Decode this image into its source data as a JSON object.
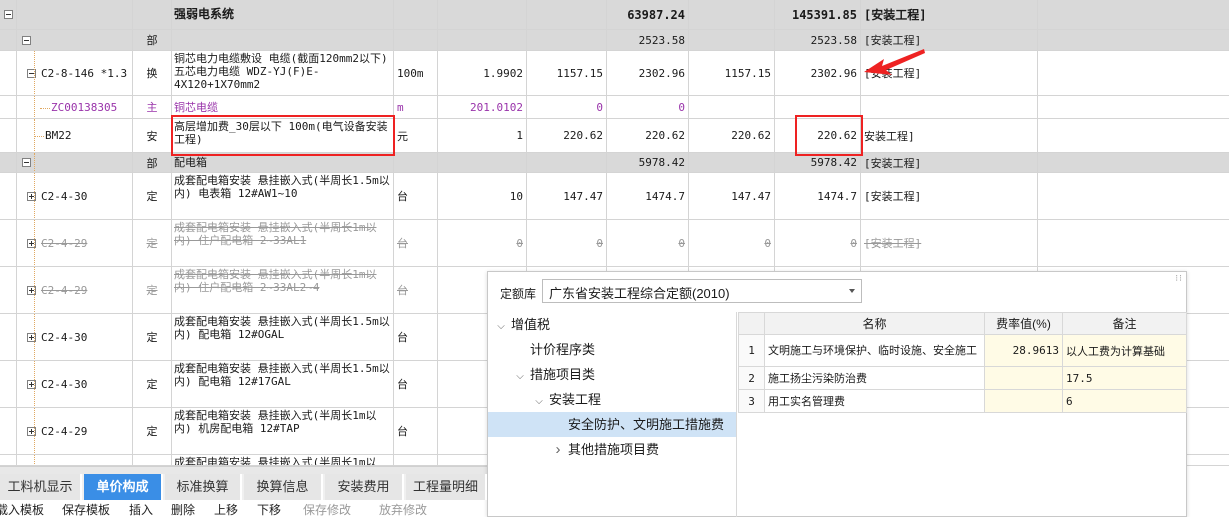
{
  "grid": {
    "rows": [
      {
        "type": "section",
        "toggle": "minus",
        "code": "",
        "category": "",
        "name": "强弱电系统",
        "unit": "",
        "qty": "",
        "unit_price": "",
        "total": "63987.24",
        "unit_price2": "",
        "total2": "145391.85",
        "fee_type": "[安装工程]"
      },
      {
        "type": "section",
        "toggle": "minus",
        "code": "",
        "category": "部",
        "name": "",
        "unit": "",
        "qty": "",
        "unit_price": "",
        "total": "2523.58",
        "unit_price2": "",
        "total2": "2523.58",
        "fee_type": "[安装工程]"
      },
      {
        "type": "normal",
        "toggle": "minus",
        "code": "C2-8-146 *1.3",
        "category": "换",
        "name": "铜芯电力电缆敷设 电缆(截面120mm2以下) 五芯电力电缆 WDZ-YJ(F)E-4X120+1X70mm2",
        "unit": "100m",
        "qty": "1.9902",
        "unit_price": "1157.15",
        "total": "2302.96",
        "unit_price2": "1157.15",
        "total2": "2302.96",
        "fee_type": "[安装工程]"
      },
      {
        "type": "normal",
        "toggle": "",
        "code": "ZC00138305",
        "category": "主",
        "name": "铜芯电缆",
        "unit": "m",
        "qty": "201.0102",
        "unit_price": "0",
        "total": "0",
        "unit_price2": "",
        "total2": "",
        "fee_type": ""
      },
      {
        "type": "normal",
        "toggle": "",
        "code": "BM22",
        "category": "安",
        "name": "高层增加费_30层以下 100m(电气设备安装工程)",
        "unit": "元",
        "qty": "1",
        "unit_price": "220.62",
        "total": "220.62",
        "unit_price2": "220.62",
        "total2": "220.62",
        "fee_type": "安装工程]"
      },
      {
        "type": "section",
        "toggle": "minus",
        "code": "",
        "category": "部",
        "name": "配电箱",
        "unit": "",
        "qty": "",
        "unit_price": "",
        "total": "5978.42",
        "unit_price2": "",
        "total2": "5978.42",
        "fee_type": "[安装工程]"
      },
      {
        "type": "normal",
        "toggle": "plus",
        "code": "C2-4-30",
        "category": "定",
        "name": "成套配电箱安装 悬挂嵌入式(半周长1.5m以内) 电表箱 12#AW1~10",
        "unit": "台",
        "qty": "10",
        "unit_price": "147.47",
        "total": "1474.7",
        "unit_price2": "147.47",
        "total2": "1474.7",
        "fee_type": "[安装工程]"
      },
      {
        "type": "struck",
        "toggle": "plus",
        "code": "C2-4-29",
        "category": "定",
        "name": "成套配电箱安装 悬挂嵌入式(半周长1m以内) 住户配电箱 2~33AL1",
        "unit": "台",
        "qty": "0",
        "unit_price": "0",
        "total": "0",
        "unit_price2": "0",
        "total2": "0",
        "fee_type": "[安装工程]"
      },
      {
        "type": "struck",
        "toggle": "plus",
        "code": "C2-4-29",
        "category": "定",
        "name": "成套配电箱安装 悬挂嵌入式(半周长1m以内) 住户配电箱 2~33AL2~4",
        "unit": "台",
        "qty": "",
        "unit_price": "",
        "total": "",
        "unit_price2": "",
        "total2": "",
        "fee_type": ""
      },
      {
        "type": "normal",
        "toggle": "plus",
        "code": "C2-4-30",
        "category": "定",
        "name": "成套配电箱安装 悬挂嵌入式(半周长1.5m以内) 配电箱 12#OGAL",
        "unit": "台",
        "qty": "",
        "unit_price": "",
        "total": "",
        "unit_price2": "",
        "total2": "",
        "fee_type": ""
      },
      {
        "type": "normal",
        "toggle": "plus",
        "code": "C2-4-30",
        "category": "定",
        "name": "成套配电箱安装 悬挂嵌入式(半周长1.5m以内) 配电箱 12#17GAL",
        "unit": "台",
        "qty": "",
        "unit_price": "",
        "total": "",
        "unit_price2": "",
        "total2": "",
        "fee_type": ""
      },
      {
        "type": "normal",
        "toggle": "plus",
        "code": "C2-4-29",
        "category": "定",
        "name": "成套配电箱安装 悬挂嵌入式(半周长1m以内) 机房配电箱 12#TAP",
        "unit": "台",
        "qty": "",
        "unit_price": "",
        "total": "",
        "unit_price2": "",
        "total2": "",
        "fee_type": ""
      },
      {
        "type": "normal",
        "toggle": "",
        "code": "",
        "category": "",
        "name": "成套配电箱安装 悬挂嵌入式(半周长1m以",
        "unit": "",
        "qty": "",
        "unit_price": "",
        "total": "",
        "unit_price2": "",
        "total2": "",
        "fee_type": ""
      }
    ]
  },
  "panel": {
    "quota_label": "定额库",
    "quota_value": "广东省安装工程综合定额(2010)",
    "tree": [
      {
        "label": "增值税",
        "level": 0,
        "chevron": "down",
        "selected": false
      },
      {
        "label": "计价程序类",
        "level": 1,
        "chevron": "",
        "selected": false
      },
      {
        "label": "措施项目类",
        "level": 1,
        "chevron": "down",
        "selected": false
      },
      {
        "label": "安装工程",
        "level": 2,
        "chevron": "down",
        "selected": false
      },
      {
        "label": "安全防护、文明施工措施费",
        "level": 3,
        "chevron": "",
        "selected": true
      },
      {
        "label": "其他措施项目费",
        "level": 3,
        "chevron": "right",
        "selected": false
      }
    ],
    "table": {
      "headers": [
        "",
        "名称",
        "费率值(%)",
        "备注"
      ],
      "rows": [
        {
          "index": "1",
          "name": "文明施工与环境保护、临时设施、安全施工",
          "rate": "28.9613",
          "note": "以人工费为计算基础"
        },
        {
          "index": "2",
          "name": "施工扬尘污染防治费",
          "rate": "",
          "note": "17.5"
        },
        {
          "index": "3",
          "name": "用工实名管理费",
          "rate": "",
          "note": "6"
        }
      ]
    }
  },
  "tabs": [
    {
      "label": "工料机显示",
      "active": false
    },
    {
      "label": "单价构成",
      "active": true
    },
    {
      "label": "标准换算",
      "active": false
    },
    {
      "label": "换算信息",
      "active": false
    },
    {
      "label": "安装费用",
      "active": false
    },
    {
      "label": "工程量明细",
      "active": false
    }
  ],
  "toolbar": [
    {
      "label": "载入模板",
      "enabled": true
    },
    {
      "label": "保存模板",
      "enabled": true
    },
    {
      "label": "插入",
      "enabled": true
    },
    {
      "label": "删除",
      "enabled": true
    },
    {
      "label": "上移",
      "enabled": true
    },
    {
      "label": "下移",
      "enabled": true
    },
    {
      "label": "保存修改",
      "enabled": false
    },
    {
      "label": "放弃修改",
      "enabled": false
    }
  ],
  "colors": {
    "accent": "#3a8ee6",
    "highlight_box": "#ee2222",
    "section_bg": "#d9d9d9",
    "purple_text": "#9933aa"
  }
}
